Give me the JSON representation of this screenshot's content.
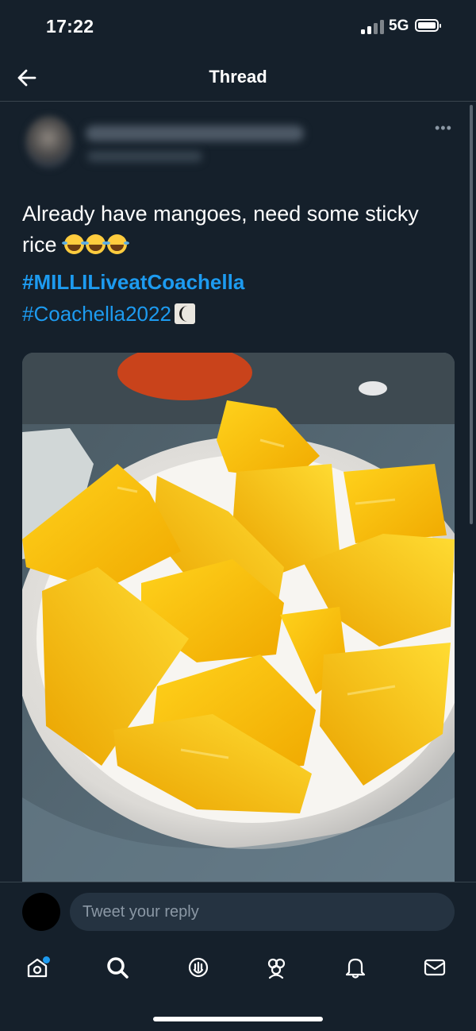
{
  "status_bar": {
    "time": "17:22",
    "network": "5G"
  },
  "nav": {
    "title": "Thread"
  },
  "tweet": {
    "text": "Already have mangoes, need some sticky rice",
    "emojis": [
      "face-with-tears-of-joy",
      "face-with-tears-of-joy",
      "face-with-tears-of-joy"
    ],
    "hashtags": [
      "#MILLILiveatCoachella",
      "#Coachella2022"
    ],
    "hashtag_emoji": "coachella-hashflag-icon",
    "image": {
      "subject": "bowl of cut mango"
    }
  },
  "reply": {
    "placeholder": "Tweet your reply"
  },
  "tabs": [
    {
      "name": "home",
      "icon": "home-icon",
      "has_notification_dot": true
    },
    {
      "name": "search",
      "icon": "search-icon"
    },
    {
      "name": "spaces",
      "icon": "spaces-icon"
    },
    {
      "name": "communities",
      "icon": "communities-icon"
    },
    {
      "name": "notifications",
      "icon": "bell-icon"
    },
    {
      "name": "messages",
      "icon": "mail-icon"
    }
  ],
  "colors": {
    "background": "#15202b",
    "accent": "#1d9bf0",
    "divider": "#38444d",
    "muted": "#8b98a5"
  }
}
